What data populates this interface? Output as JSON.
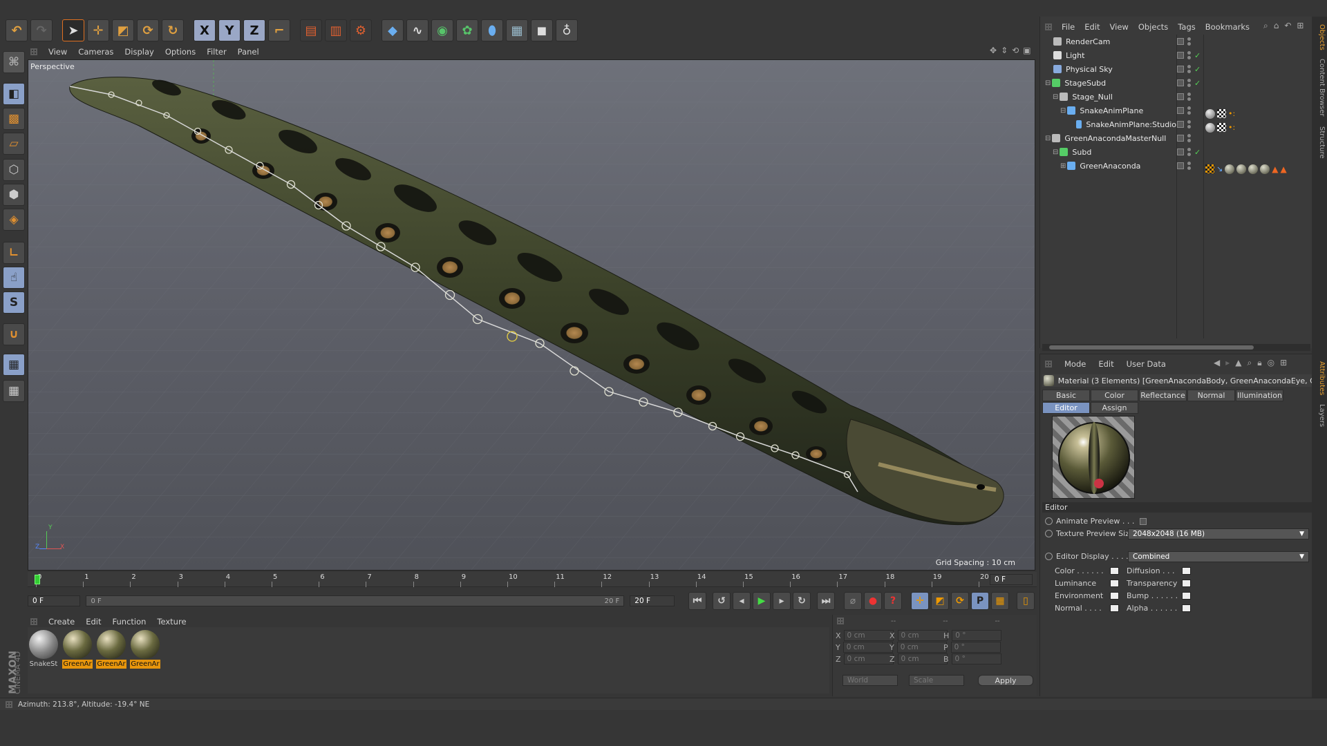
{
  "toolbar": {
    "icons": [
      "undo-icon",
      "redo-icon",
      "live-selection-icon",
      "move-icon",
      "scale-icon",
      "rotate-icon",
      "recent-tool-icon",
      "x-axis-lock-icon",
      "y-axis-lock-icon",
      "z-axis-lock-icon",
      "coordinate-system-icon",
      "render-view-icon",
      "render-to-picture-viewer-icon",
      "edit-render-settings-icon",
      "cube-primitive-icon",
      "spline-pen-icon",
      "subdivision-surface-icon",
      "array-generator-icon",
      "deformer-icon",
      "floor-environment-icon",
      "camera-icon",
      "light-icon"
    ],
    "axis_labels": [
      "X",
      "Y",
      "Z"
    ]
  },
  "left_tools": [
    "make-editable-icon",
    "model-mode-icon",
    "texture-mode-icon",
    "workplane-icon",
    "points-mode-icon",
    "edges-mode-icon",
    "polygons-mode-icon",
    "axis-mode-icon",
    "tweak-mode-icon",
    "sculpt-icon",
    "magnet-icon",
    "snap-icon",
    "quantize-icon"
  ],
  "viewport": {
    "menu": [
      "View",
      "Cameras",
      "Display",
      "Options",
      "Filter",
      "Panel"
    ],
    "label": "Perspective",
    "grid_spacing": "Grid Spacing : 10 cm",
    "axis": {
      "y": "Y",
      "z": "Z",
      "x": "X"
    }
  },
  "object_manager": {
    "menu": [
      "File",
      "Edit",
      "View",
      "Objects",
      "Tags",
      "Bookmarks"
    ],
    "objects": [
      {
        "name": "RenderCam",
        "indent": 0,
        "icon": "camera-icon",
        "color": "#bbbbbb",
        "check": false
      },
      {
        "name": "Light",
        "indent": 0,
        "icon": "light-icon",
        "color": "#dddddd",
        "check": true
      },
      {
        "name": "Physical Sky",
        "indent": 0,
        "icon": "sky-icon",
        "color": "#88aadd",
        "check": true
      },
      {
        "name": "StageSubd",
        "indent": 0,
        "icon": "subdivision-icon",
        "color": "#55cc66",
        "check": true,
        "expand": "-"
      },
      {
        "name": "Stage_Null",
        "indent": 1,
        "icon": "null-icon",
        "color": "#bbbbbb",
        "check": false,
        "expand": "-"
      },
      {
        "name": "SnakeAnimPlane",
        "indent": 2,
        "icon": "plane-icon",
        "color": "#6aaef0",
        "check": false,
        "expand": "-"
      },
      {
        "name": "SnakeAnimPlane:Studio",
        "indent": 3,
        "icon": "plane-icon",
        "color": "#6aaef0",
        "check": false
      },
      {
        "name": "GreenAnacondaMasterNull",
        "indent": 0,
        "icon": "null-icon",
        "color": "#bbbbbb",
        "check": false,
        "expand": "-"
      },
      {
        "name": "Subd",
        "indent": 1,
        "icon": "subdivision-icon",
        "color": "#55cc66",
        "check": true,
        "expand": "-"
      },
      {
        "name": "GreenAnaconda",
        "indent": 2,
        "icon": "polygon-icon",
        "color": "#6aaef0",
        "check": false,
        "expand": "+"
      }
    ]
  },
  "attributes": {
    "menu": [
      "Mode",
      "Edit",
      "User Data"
    ],
    "title": "Material (3 Elements) [GreenAnacondaBody, GreenAnacondaEye, Green",
    "tabs_row1": [
      "Basic",
      "Color",
      "Reflectance",
      "Normal",
      "Illumination"
    ],
    "tabs_row2": [
      "Editor",
      "Assign"
    ],
    "section": "Editor",
    "animate_preview": "Animate Preview . . .",
    "texture_preview_size_label": "Texture Preview Size",
    "texture_preview_size_value": "2048x2048 (16 MB)",
    "editor_display_label": "Editor Display . . . . .",
    "editor_display_value": "Combined",
    "channels_left": [
      "Color . . . . . .",
      "Luminance",
      "Environment",
      "Normal . . . ."
    ],
    "channels_right": [
      "Diffusion . . .",
      "Transparency",
      "Bump . . . . . .",
      "Alpha . . . . . ."
    ]
  },
  "timeline": {
    "ticks": [
      "0",
      "1",
      "2",
      "3",
      "4",
      "5",
      "6",
      "7",
      "8",
      "9",
      "10",
      "11",
      "12",
      "13",
      "14",
      "15",
      "16",
      "17",
      "18",
      "19",
      "20"
    ],
    "current_frame": "0 F",
    "start": "0 F",
    "range_start": "0 F",
    "range_end": "20 F",
    "end": "20 F",
    "end_field": "0 F"
  },
  "material_manager": {
    "menu": [
      "Create",
      "Edit",
      "Function",
      "Texture"
    ],
    "materials": [
      {
        "name": "SnakeSt",
        "selected": false
      },
      {
        "name": "GreenAr",
        "selected": true
      },
      {
        "name": "GreenAr",
        "selected": true
      },
      {
        "name": "GreenAr",
        "selected": true
      }
    ]
  },
  "coordinates": {
    "headers": [
      "--",
      "--",
      "--"
    ],
    "rows": [
      {
        "a": "X",
        "av": "0 cm",
        "b": "X",
        "bv": "0 cm",
        "c": "H",
        "cv": "0 °"
      },
      {
        "a": "Y",
        "av": "0 cm",
        "b": "Y",
        "bv": "0 cm",
        "c": "P",
        "cv": "0 °"
      },
      {
        "a": "Z",
        "av": "0 cm",
        "b": "Z",
        "bv": "0 cm",
        "c": "B",
        "cv": "0 °"
      }
    ],
    "world": "World",
    "scale": "Scale",
    "apply": "Apply"
  },
  "status": "Azimuth: 213.8°, Altitude: -19.4°  NE",
  "brand": {
    "line1": "MAXON",
    "line2": "CINEMA 4D"
  },
  "side_tabs": [
    "Objects",
    "Content Browser",
    "Structure",
    "Attributes",
    "Layers"
  ]
}
